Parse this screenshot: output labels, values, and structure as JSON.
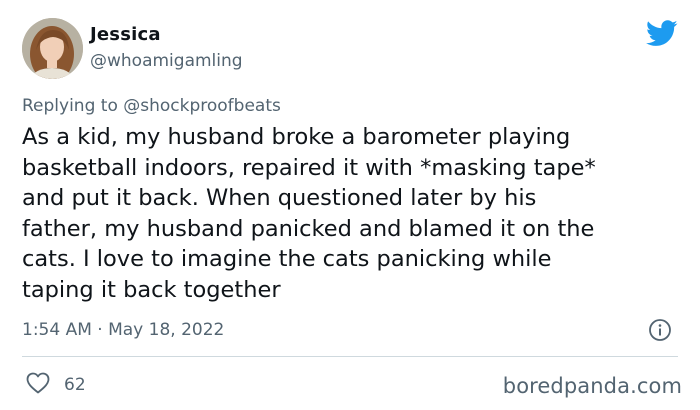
{
  "author": {
    "name": "Jessica",
    "handle": "@whoamigamling"
  },
  "reply": {
    "prefix": "Replying to ",
    "mention": "@shockproofbeats"
  },
  "tweet": {
    "text": "As a kid, my husband broke a barometer playing\nbasketball indoors, repaired it with *masking tape*\nand put it back. When questioned later by his\nfather, my husband panicked and blamed it on the\ncats. I love to imagine the cats panicking while\ntaping it back together",
    "timestamp": "1:54 AM · May 18, 2022",
    "likes": "62"
  },
  "watermark": "boredpanda.com",
  "icons": {
    "brand": "twitter-bird-icon",
    "info": "info-icon",
    "like": "heart-icon"
  },
  "colors": {
    "twitter_blue": "#1d9bf0",
    "secondary_text": "#536471",
    "divider": "#cfd9de"
  }
}
